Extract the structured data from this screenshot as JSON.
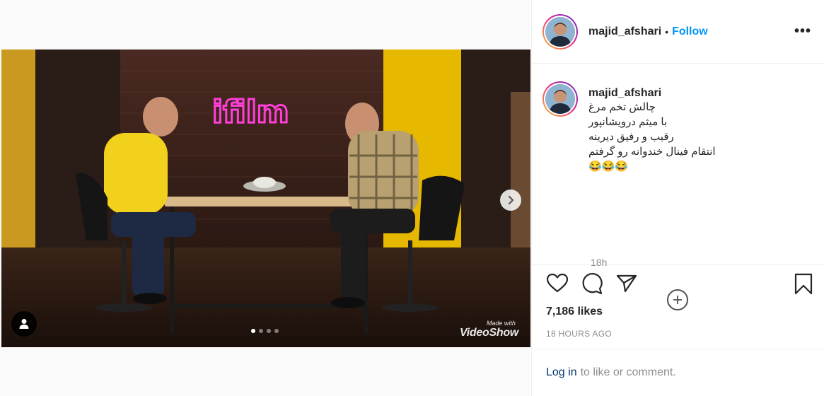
{
  "post": {
    "username": "majid_afshari",
    "separator": "•",
    "follow_label": "Follow",
    "more_label": "•••",
    "caption_lines": [
      "چالش تخم مرغ",
      "با میثم درویشانپور",
      "رقیب و رفیق دیرینه",
      "انتقام فینال خندوانه رو گرفتم",
      "😂😂😂"
    ],
    "time_ago": "18h",
    "likes": "7,186 likes",
    "posted": "18 HOURS AGO",
    "login_label": "Log in",
    "login_suffix": "to like or comment."
  },
  "media": {
    "neon_sign": "ifilm",
    "watermark_line1": "Made with",
    "watermark_line2": "VideoShow",
    "carousel_count": 4,
    "carousel_active": 1
  },
  "icons": {
    "next": "chevron-right-icon",
    "tag": "user-tag-icon",
    "load_more": "plus-circle-icon",
    "like": "heart-icon",
    "comment": "comment-icon",
    "share": "paper-plane-icon",
    "save": "bookmark-icon"
  },
  "colors": {
    "follow": "#0095f6",
    "neon": "#ff3fd8",
    "link": "#00376b"
  }
}
